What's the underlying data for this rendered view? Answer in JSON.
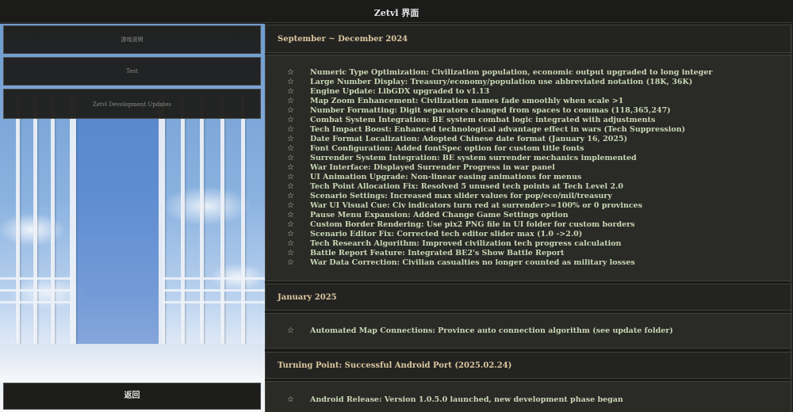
{
  "window": {
    "title": "Zetvl 界面"
  },
  "sidebar": {
    "buttons": [
      {
        "label": "游戏说明"
      },
      {
        "label": "Test"
      },
      {
        "label": "Zetvl Development Updates"
      }
    ],
    "back_label": "返回"
  },
  "icons": {
    "bullet": "star-icon"
  },
  "colors": {
    "header_text": "#dcc8a0",
    "item_text": "#c9d7b4",
    "background": "#1a1a19"
  },
  "updates": {
    "sections": [
      {
        "heading": "September ~ December 2024",
        "items": [
          "Numeric Type Optimization: Civilization population, economic output upgraded to long integer",
          "Large Number Display: Treasury/economy/population use abbreviated notation (18K, 36K)",
          "Engine Update: LibGDX upgraded to v1.13",
          "Map Zoom Enhancement: Civilization names fade smoothly when scale >1",
          "Number Formatting: Digit separators changed from spaces to commas (118,365,247)",
          "Combat System Integration: BE system combat logic integrated with adjustments",
          "Tech Impact Boost: Enhanced technological advantage effect in wars (Tech Suppression)",
          "Date Format Localization: Adopted Chinese date format (January 16, 2025)",
          "Font Configuration: Added fontSpec option for custom title fonts",
          "Surrender System Integration: BE system surrender mechanics implemented",
          "War Interface: Displayed Surrender Progress in war panel",
          "UI Animation Upgrade: Non-linear easing animations for menus",
          "Tech Point Allocation Fix: Resolved 5 unused tech points at Tech Level 2.0",
          "Scenario Settings: Increased max slider values for pop/eco/mil/treasury",
          "War UI Visual Cue: Civ indicators turn red at surrender>=100% or 0 provinces",
          "Pause Menu Expansion: Added Change Game Settings option",
          "Custom Border Rendering: Use pix2 PNG file in UI folder for custom borders",
          "Scenario Editor Fix: Corrected tech editor slider max (1.0 ->2.0)",
          "Tech Research Algorithm: Improved civilization tech progress calculation",
          "Battle Report Feature: Integrated BE2's Show Battle Report",
          "War Data Correction: Civilian casualties no longer counted as military losses"
        ]
      },
      {
        "heading": "January 2025",
        "items": [
          "Automated Map Connections: Province auto connection algorithm (see update folder)"
        ]
      },
      {
        "heading": "Turning Point: Successful Android Port (2025.02.24)",
        "items": [
          "Android Release: Version 1.0.5.0 launched, new development phase began"
        ]
      }
    ]
  }
}
